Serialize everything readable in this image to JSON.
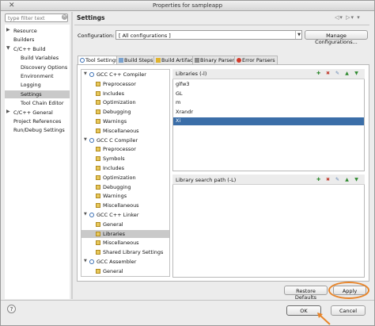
{
  "window": {
    "title": "Properties for sampleapp"
  },
  "filter": {
    "placeholder": "type filter text"
  },
  "nav": {
    "items": [
      {
        "label": "Resource",
        "expander": "right"
      },
      {
        "label": "Builders",
        "expander": ""
      },
      {
        "label": "C/C++ Build",
        "expander": "down"
      },
      {
        "label": "Build Variables",
        "expander": ""
      },
      {
        "label": "Discovery Options",
        "expander": ""
      },
      {
        "label": "Environment",
        "expander": ""
      },
      {
        "label": "Logging",
        "expander": ""
      },
      {
        "label": "Settings",
        "expander": "",
        "selected": true
      },
      {
        "label": "Tool Chain Editor",
        "expander": ""
      },
      {
        "label": "C/C++ General",
        "expander": "right"
      },
      {
        "label": "Project References",
        "expander": ""
      },
      {
        "label": "Run/Debug Settings",
        "expander": ""
      }
    ]
  },
  "header": {
    "title": "Settings"
  },
  "config": {
    "label": "Configuration:",
    "value": "[ All configurations ]",
    "manage_button": "Manage Configurations..."
  },
  "tabs": [
    {
      "label": "Tool Settings",
      "active": true
    },
    {
      "label": "Build Steps"
    },
    {
      "label": "Build Artifact"
    },
    {
      "label": "Binary Parsers"
    },
    {
      "label": "Error Parsers"
    }
  ],
  "tool_tree": [
    {
      "label": "GCC C++ Compiler",
      "kind": "tool"
    },
    {
      "label": "Preprocessor",
      "kind": "option"
    },
    {
      "label": "Includes",
      "kind": "option"
    },
    {
      "label": "Optimization",
      "kind": "option"
    },
    {
      "label": "Debugging",
      "kind": "option"
    },
    {
      "label": "Warnings",
      "kind": "option"
    },
    {
      "label": "Miscellaneous",
      "kind": "option"
    },
    {
      "label": "GCC C Compiler",
      "kind": "tool"
    },
    {
      "label": "Preprocessor",
      "kind": "option"
    },
    {
      "label": "Symbols",
      "kind": "option"
    },
    {
      "label": "Includes",
      "kind": "option"
    },
    {
      "label": "Optimization",
      "kind": "option"
    },
    {
      "label": "Debugging",
      "kind": "option"
    },
    {
      "label": "Warnings",
      "kind": "option"
    },
    {
      "label": "Miscellaneous",
      "kind": "option"
    },
    {
      "label": "GCC C++ Linker",
      "kind": "tool"
    },
    {
      "label": "General",
      "kind": "option"
    },
    {
      "label": "Libraries",
      "kind": "option",
      "selected": true
    },
    {
      "label": "Miscellaneous",
      "kind": "option"
    },
    {
      "label": "Shared Library Settings",
      "kind": "option"
    },
    {
      "label": "GCC Assembler",
      "kind": "tool"
    },
    {
      "label": "General",
      "kind": "option"
    }
  ],
  "libraries": {
    "title": "Libraries (-l)",
    "items": [
      "glfw3",
      "GL",
      "m",
      "Xrandr",
      "Xi"
    ],
    "selected_index": 4
  },
  "library_paths": {
    "title": "Library search path (-L)",
    "items": []
  },
  "buttons": {
    "restore_defaults": "Restore Defaults",
    "apply": "Apply",
    "ok": "OK",
    "cancel": "Cancel",
    "help": "?"
  },
  "colors": {
    "highlight": "#e8852a",
    "selection": "#3b6ea8"
  }
}
